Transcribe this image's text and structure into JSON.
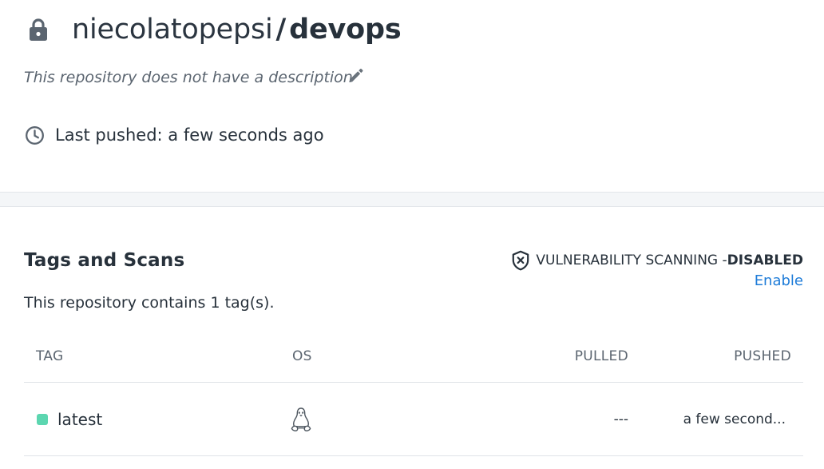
{
  "repository": {
    "owner": "niecolatopepsi",
    "separator": "/",
    "name": "devops",
    "description": "This repository does not have a description",
    "last_pushed": "Last pushed: a few seconds ago"
  },
  "tags_section": {
    "title": "Tags and Scans",
    "vulnerability_label": "VULNERABILITY SCANNING - ",
    "vulnerability_status": "DISABLED",
    "enable_label": "Enable",
    "tag_count_text": "This repository contains 1 tag(s).",
    "columns": [
      "TAG",
      "OS",
      "PULLED",
      "PUSHED"
    ],
    "rows": [
      {
        "tag": "latest",
        "os": "linux-icon",
        "pulled": "---",
        "pushed": "a few second..."
      }
    ]
  },
  "colors": {
    "text": "#27313b",
    "muted": "#5b6570",
    "link": "#1d7bd8",
    "tag_dot": "#5cd6b0"
  }
}
